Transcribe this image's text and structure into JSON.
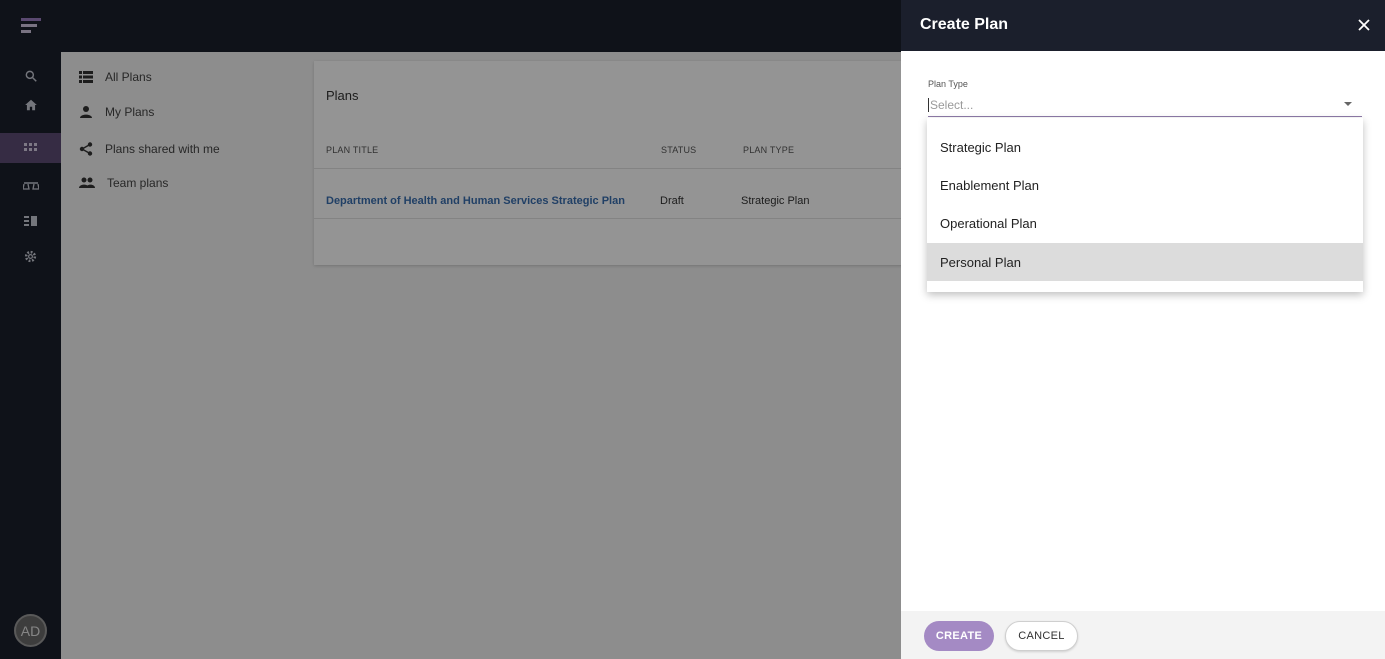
{
  "rail": {
    "items": [
      "search-icon",
      "home-icon",
      "apps-icon",
      "balance-scale-icon",
      "list-icon",
      "gear-icon"
    ],
    "active_item": "apps-icon",
    "avatar_initials": "AD"
  },
  "nav": {
    "items": [
      {
        "label": "All Plans",
        "icon": "list-icon"
      },
      {
        "label": "My Plans",
        "icon": "person-icon"
      },
      {
        "label": "Plans shared with me",
        "icon": "share-icon"
      },
      {
        "label": "Team plans",
        "icon": "group-icon"
      }
    ]
  },
  "plans": {
    "title": "Plans",
    "columns": [
      "PLAN TITLE",
      "STATUS",
      "PLAN TYPE"
    ],
    "rows": [
      {
        "title": "Department of Health and Human Services Strategic Plan",
        "status": "Draft",
        "type": "Strategic Plan"
      }
    ]
  },
  "panel": {
    "title": "Create Plan",
    "field_label": "Plan Type",
    "placeholder": "Select...",
    "options": [
      "Strategic Plan",
      "Enablement Plan",
      "Operational Plan",
      "Personal Plan"
    ],
    "hovered_option": "Personal Plan",
    "create_label": "CREATE",
    "cancel_label": "CANCEL"
  },
  "colors": {
    "dark_nav": "#1b1f2c",
    "accent": "#a48ac4",
    "link": "#3a6fb0"
  }
}
